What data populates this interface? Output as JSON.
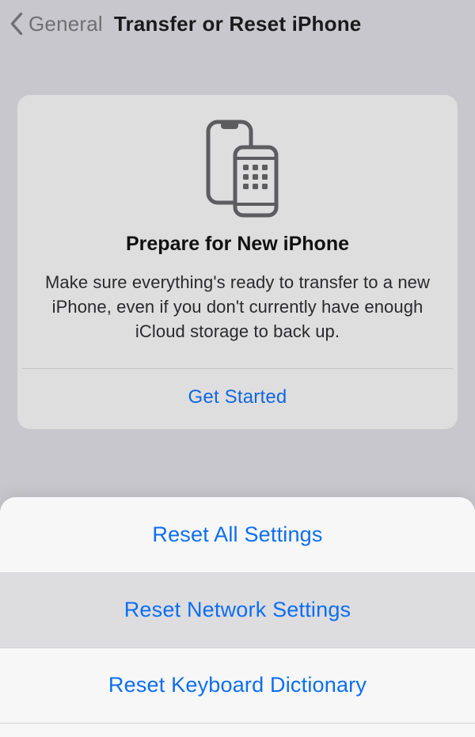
{
  "nav": {
    "back_label": "General",
    "title": "Transfer or Reset iPhone"
  },
  "card": {
    "title": "Prepare for New iPhone",
    "body": "Make sure everything's ready to transfer to a new iPhone, even if you don't currently have enough iCloud storage to back up.",
    "action": "Get Started"
  },
  "sheet": {
    "options": [
      "Reset All Settings",
      "Reset Network Settings",
      "Reset Keyboard Dictionary"
    ],
    "highlighted_index": 1
  },
  "colors": {
    "link": "#0d6ef2",
    "background": "#c8c7cd",
    "card": "#dededf"
  }
}
